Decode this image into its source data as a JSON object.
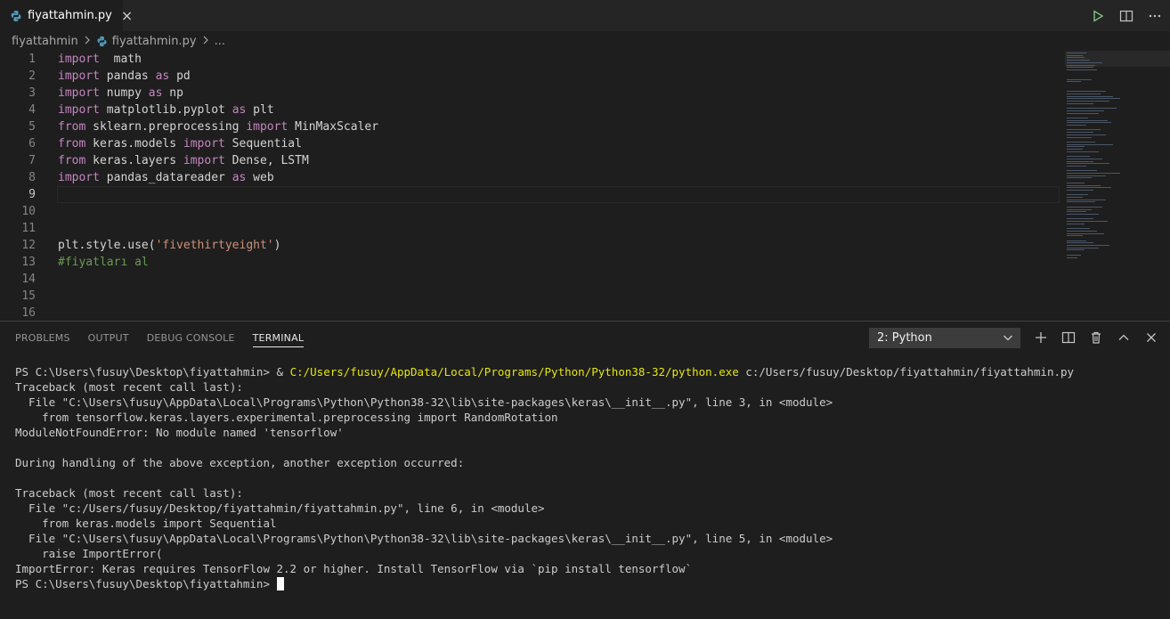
{
  "tab": {
    "filename": "fiyattahmin.py",
    "close_icon": "×"
  },
  "breadcrumb": {
    "folder": "fiyattahmin",
    "file": "fiyattahmin.py",
    "ellipsis": "..."
  },
  "editor": {
    "lines": [
      {
        "num": "1",
        "tokens": [
          [
            "kw",
            "import"
          ],
          [
            "",
            "  math"
          ]
        ]
      },
      {
        "num": "2",
        "tokens": [
          [
            "kw",
            "import"
          ],
          [
            "",
            " pandas "
          ],
          [
            "kw",
            "as"
          ],
          [
            "",
            " pd"
          ]
        ]
      },
      {
        "num": "3",
        "tokens": [
          [
            "kw",
            "import"
          ],
          [
            "",
            " numpy "
          ],
          [
            "kw",
            "as"
          ],
          [
            "",
            " np"
          ]
        ]
      },
      {
        "num": "4",
        "tokens": [
          [
            "kw",
            "import"
          ],
          [
            "",
            " matplotlib.pyplot "
          ],
          [
            "kw",
            "as"
          ],
          [
            "",
            " plt"
          ]
        ]
      },
      {
        "num": "5",
        "tokens": [
          [
            "kw",
            "from"
          ],
          [
            "",
            " sklearn.preprocessing "
          ],
          [
            "kw",
            "import"
          ],
          [
            "",
            " MinMaxScaler"
          ]
        ]
      },
      {
        "num": "6",
        "tokens": [
          [
            "kw",
            "from"
          ],
          [
            "",
            " keras.models "
          ],
          [
            "kw",
            "import"
          ],
          [
            "",
            " Sequential"
          ]
        ]
      },
      {
        "num": "7",
        "tokens": [
          [
            "kw",
            "from"
          ],
          [
            "",
            " keras.layers "
          ],
          [
            "kw",
            "import"
          ],
          [
            "",
            " Dense, LSTM"
          ]
        ]
      },
      {
        "num": "8",
        "tokens": [
          [
            "kw",
            "import"
          ],
          [
            "",
            " pandas_datareader "
          ],
          [
            "kw",
            "as"
          ],
          [
            "",
            " web"
          ]
        ]
      },
      {
        "num": "9",
        "tokens": []
      },
      {
        "num": "10",
        "tokens": []
      },
      {
        "num": "11",
        "tokens": []
      },
      {
        "num": "12",
        "tokens": [
          [
            "",
            "plt.style.use("
          ],
          [
            "str",
            "'fivethirtyeight'"
          ],
          [
            "",
            ")"
          ]
        ]
      },
      {
        "num": "13",
        "tokens": [
          [
            "com",
            "#fiyatları al"
          ]
        ]
      },
      {
        "num": "14",
        "tokens": []
      },
      {
        "num": "15",
        "tokens": []
      },
      {
        "num": "16",
        "tokens": []
      }
    ],
    "current_line": 9
  },
  "panel": {
    "tabs": [
      "PROBLEMS",
      "OUTPUT",
      "DEBUG CONSOLE",
      "TERMINAL"
    ],
    "active_tab": "TERMINAL",
    "terminal_select": "2: Python"
  },
  "terminal": {
    "lines": [
      [
        [
          "",
          "PS C:\\Users\\fusuy\\Desktop\\fiyattahmin> & "
        ],
        [
          "path",
          "C:/Users/fusuy/AppData/Local/Programs/Python/Python38-32/python.exe"
        ],
        [
          "",
          " c:/Users/fusuy/Desktop/fiyattahmin/fiyattahmin.py"
        ]
      ],
      [
        [
          "",
          "Traceback (most recent call last):"
        ]
      ],
      [
        [
          "",
          "  File \"C:\\Users\\fusuy\\AppData\\Local\\Programs\\Python\\Python38-32\\lib\\site-packages\\keras\\__init__.py\", line 3, in <module>"
        ]
      ],
      [
        [
          "",
          "    from tensorflow.keras.layers.experimental.preprocessing import RandomRotation"
        ]
      ],
      [
        [
          "",
          "ModuleNotFoundError: No module named 'tensorflow'"
        ]
      ],
      [],
      [
        [
          "",
          "During handling of the above exception, another exception occurred:"
        ]
      ],
      [],
      [
        [
          "",
          "Traceback (most recent call last):"
        ]
      ],
      [
        [
          "",
          "  File \"c:/Users/fusuy/Desktop/fiyattahmin/fiyattahmin.py\", line 6, in <module>"
        ]
      ],
      [
        [
          "",
          "    from keras.models import Sequential"
        ]
      ],
      [
        [
          "",
          "  File \"C:\\Users\\fusuy\\AppData\\Local\\Programs\\Python\\Python38-32\\lib\\site-packages\\keras\\__init__.py\", line 5, in <module>"
        ]
      ],
      [
        [
          "",
          "    raise ImportError("
        ]
      ],
      [
        [
          "",
          "ImportError: Keras requires TensorFlow 2.2 or higher. Install TensorFlow via `pip install tensorflow`"
        ]
      ],
      [
        [
          "",
          "PS C:\\Users\\fusuy\\Desktop\\fiyattahmin> "
        ],
        [
          "cursor",
          ""
        ]
      ]
    ]
  },
  "colors": {
    "accent_blue": "#519aba",
    "keyword": "#c586c0",
    "string": "#ce9178",
    "comment": "#6a9955",
    "run_green": "#89d185",
    "terminal_path": "#e5e510"
  },
  "icons": [
    "python-file-icon",
    "close-icon",
    "run-icon",
    "split-editor-icon",
    "more-actions-icon",
    "chevron-right-icon",
    "chevron-down-icon",
    "add-terminal-icon",
    "split-terminal-icon",
    "trash-icon",
    "maximize-panel-icon",
    "close-panel-icon"
  ]
}
